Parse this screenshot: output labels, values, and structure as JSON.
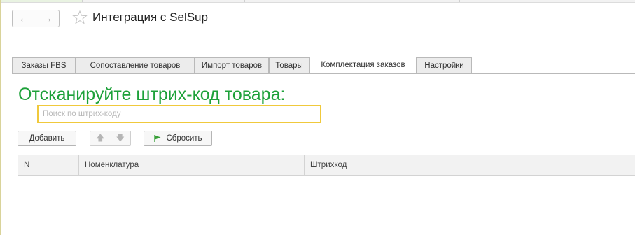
{
  "window": {
    "back_glyph": "←",
    "forward_glyph": "→",
    "title": "Интеграция с SelSup"
  },
  "tabs": [
    {
      "label": "Заказы FBS",
      "active": false
    },
    {
      "label": "Сопоставление товаров",
      "active": false
    },
    {
      "label": "Импорт товаров",
      "active": false
    },
    {
      "label": "Товары",
      "active": false
    },
    {
      "label": "Комплектация заказов",
      "active": true
    },
    {
      "label": "Настройки",
      "active": false
    }
  ],
  "form": {
    "heading": "Отсканируйте штрих-код товара:",
    "search_placeholder": "Поиск по штрих-коду",
    "search_value": ""
  },
  "toolbar": {
    "add_label": "Добавить",
    "up_glyph": "🡅",
    "down_glyph": "🡇",
    "reset_label": "Сбросить"
  },
  "table": {
    "columns": [
      "N",
      "Номенклатура",
      "Штрихкод"
    ],
    "rows": []
  },
  "colors": {
    "heading": "#1ea13a",
    "search_border": "#f0c93c",
    "flag": "#3aa03a"
  }
}
